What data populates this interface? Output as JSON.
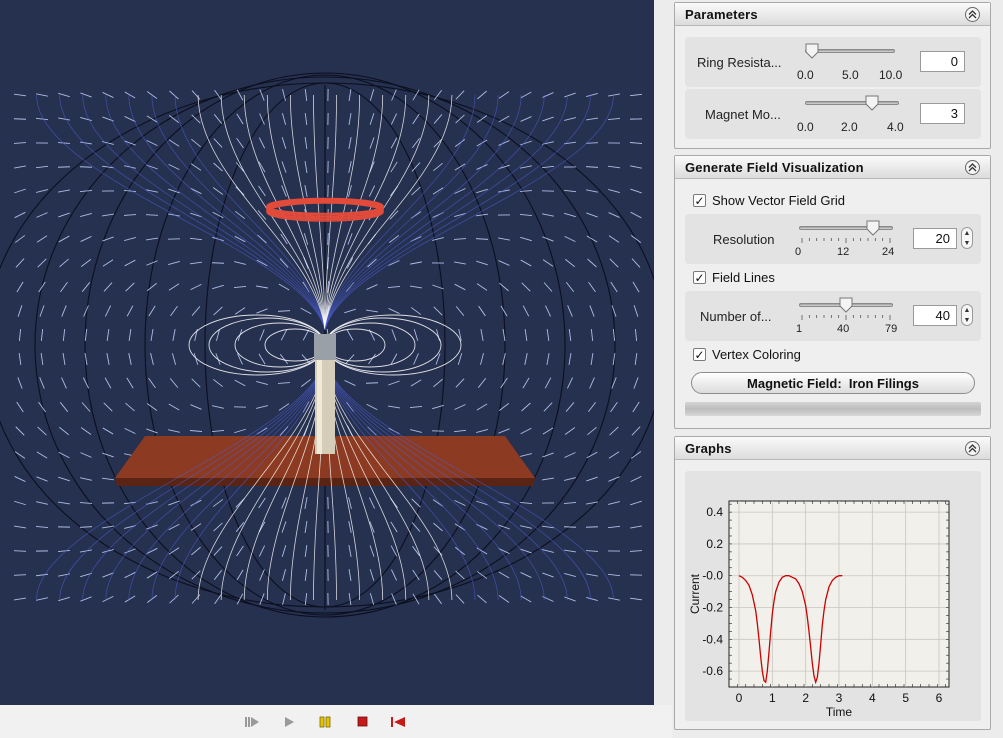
{
  "colors": {
    "scene_bg": "#26314f",
    "field_line_inner": "#ffffff",
    "field_line_outer": "#4f5fd8",
    "ring": "#e24a3a",
    "table": "#8c3b22",
    "curve": "#cc0000",
    "grid_bg": "#f2f0ea"
  },
  "playback": {
    "step_icon": "step-forward-icon",
    "play_icon": "play-icon",
    "pause_icon": "pause-icon",
    "stop_icon": "stop-icon",
    "reset_icon": "reset-icon"
  },
  "parameters": {
    "title": "Parameters",
    "collapse_icon": "chevron-up-icon",
    "ring_resistance": {
      "label": "Ring Resista...",
      "ticks": [
        "0.0",
        "5.0",
        "10.0"
      ],
      "value": "0",
      "fraction": 0.0
    },
    "magnet_moment": {
      "label": "Magnet Mo...",
      "ticks": [
        "0.0",
        "2.0",
        "4.0"
      ],
      "value": "3",
      "fraction": 0.75
    }
  },
  "visualization": {
    "title": "Generate Field Visualization",
    "collapse_icon": "chevron-up-icon",
    "show_vector_grid": {
      "label": "Show Vector Field Grid",
      "checked": true
    },
    "resolution": {
      "label": "Resolution",
      "ticks": [
        "0",
        "12",
        "24"
      ],
      "value": "20",
      "fraction": 0.8333
    },
    "field_lines": {
      "label": "Field Lines",
      "checked": true
    },
    "number_of_lines": {
      "label": "Number of...",
      "ticks": [
        "1",
        "40",
        "79"
      ],
      "value": "40",
      "fraction": 0.5
    },
    "vertex_coloring": {
      "label": "Vertex Coloring",
      "checked": true
    },
    "field_button": "Magnetic Field:  Iron Filings"
  },
  "graphs": {
    "title": "Graphs",
    "collapse_icon": "chevron-up-icon"
  },
  "chart_data": {
    "type": "line",
    "title": "",
    "xlabel": "Time",
    "ylabel": "Current",
    "xlim": [
      -0.3,
      6.3
    ],
    "ylim": [
      -0.7,
      0.47
    ],
    "xticks": [
      "0",
      "1",
      "2",
      "3",
      "4",
      "5",
      "6"
    ],
    "yticks": [
      "0.4",
      "0.2",
      "-0.0",
      "-0.2",
      "-0.4",
      "-0.6"
    ],
    "grid": true,
    "series": [
      {
        "x": [
          0.0,
          0.1,
          0.2,
          0.3,
          0.4,
          0.5,
          0.55,
          0.6,
          0.65,
          0.7,
          0.75,
          0.8,
          0.85,
          0.9,
          0.95,
          1.0,
          1.05,
          1.1,
          1.2,
          1.3,
          1.4,
          1.5,
          1.6,
          1.7,
          1.8,
          1.9,
          2.0,
          2.05,
          2.1,
          2.15,
          2.2,
          2.25,
          2.3,
          2.35,
          2.4,
          2.45,
          2.5,
          2.55,
          2.6,
          2.7,
          2.8,
          2.9,
          3.0,
          3.1
        ],
        "y": [
          0.0,
          -0.01,
          -0.03,
          -0.06,
          -0.12,
          -0.22,
          -0.3,
          -0.4,
          -0.51,
          -0.6,
          -0.66,
          -0.67,
          -0.6,
          -0.48,
          -0.35,
          -0.24,
          -0.16,
          -0.1,
          -0.04,
          -0.01,
          0.0,
          0.0,
          -0.01,
          -0.02,
          -0.05,
          -0.1,
          -0.19,
          -0.26,
          -0.35,
          -0.45,
          -0.55,
          -0.63,
          -0.67,
          -0.64,
          -0.55,
          -0.43,
          -0.31,
          -0.22,
          -0.15,
          -0.07,
          -0.03,
          -0.01,
          0.0,
          0.0
        ]
      }
    ]
  }
}
